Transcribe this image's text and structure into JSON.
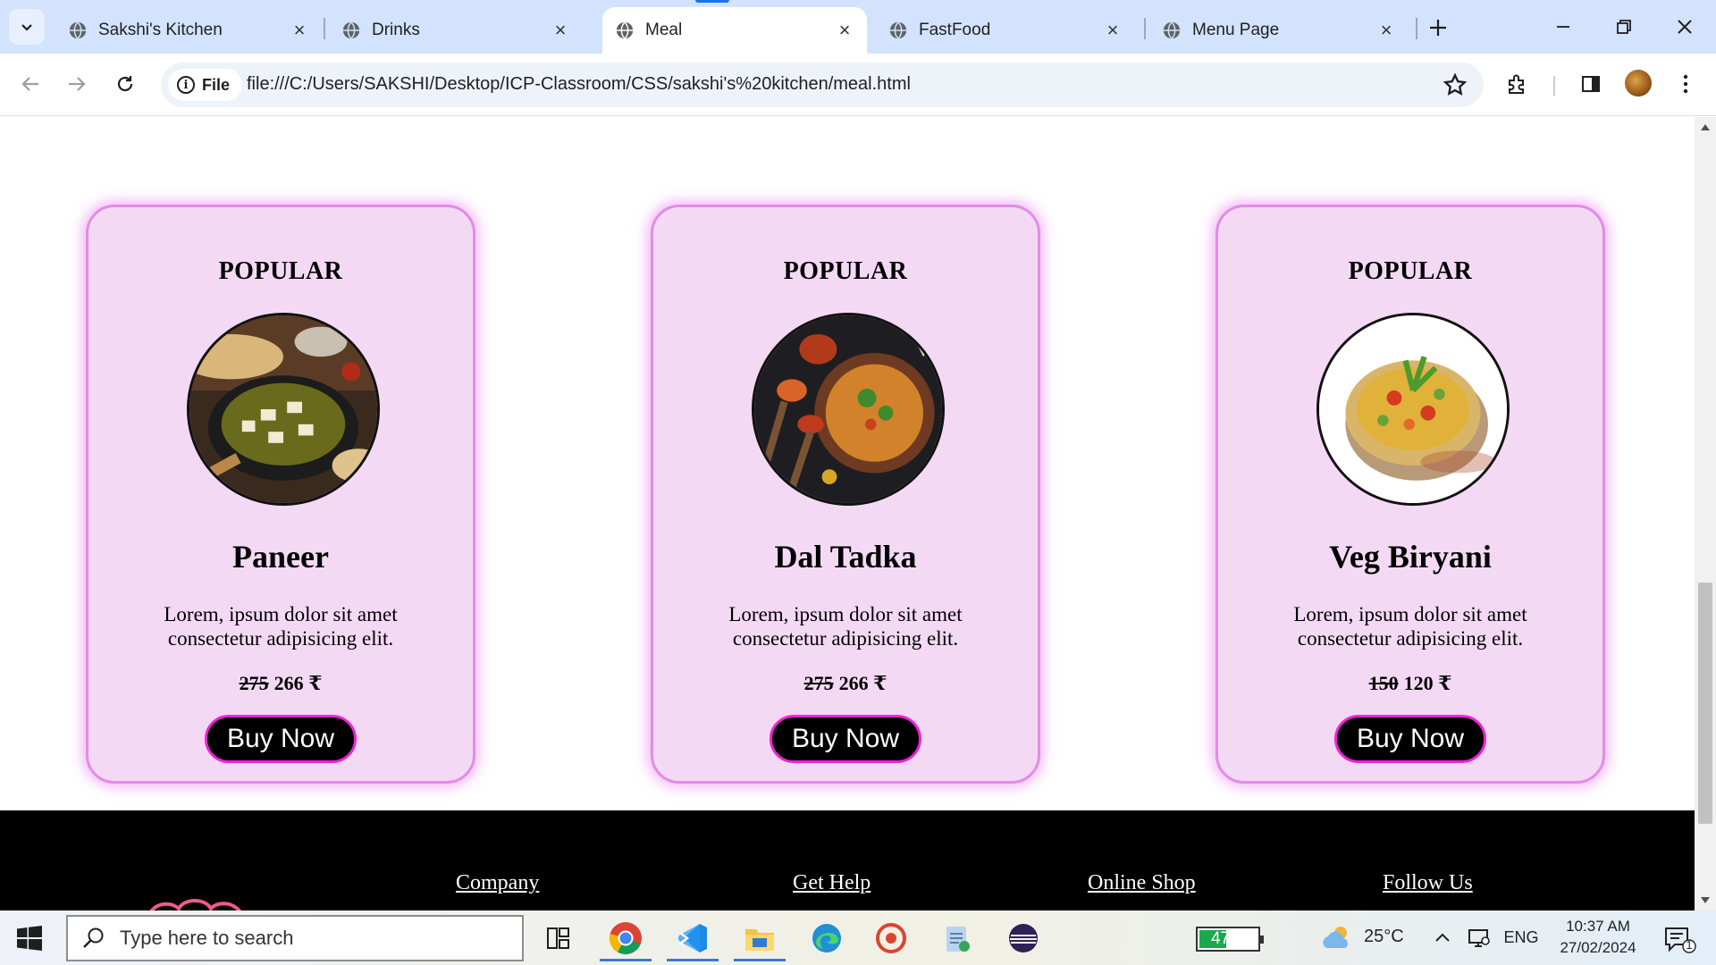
{
  "browser": {
    "tabs": [
      {
        "title": "Sakshi's Kitchen",
        "active": false
      },
      {
        "title": "Drinks",
        "active": false
      },
      {
        "title": "Meal",
        "active": true
      },
      {
        "title": "FastFood",
        "active": false
      },
      {
        "title": "Menu Page",
        "active": false
      }
    ],
    "site_chip_label": "File",
    "url": "file:///C:/Users/SAKSHI/Desktop/ICP-Classroom/CSS/sakshi's%20kitchen/meal.html",
    "accent_color": "#1a73e8"
  },
  "page": {
    "cards": [
      {
        "badge": "POPULAR",
        "name": "Paneer",
        "description": "Lorem, ipsum dolor sit amet consectetur adipisicing elit.",
        "old_price": "275",
        "price": "266 ₹",
        "button": "Buy Now",
        "image_icon": "paneer-dish-image"
      },
      {
        "badge": "POPULAR",
        "name": "Dal Tadka",
        "description": "Lorem, ipsum dolor sit amet consectetur adipisicing elit.",
        "old_price": "275",
        "price": "266 ₹",
        "button": "Buy Now",
        "image_icon": "dal-tadka-dish-image"
      },
      {
        "badge": "POPULAR",
        "name": "Veg Biryani",
        "description": "Lorem, ipsum dolor sit amet consectetur adipisicing elit.",
        "old_price": "150",
        "price": "120 ₹",
        "button": "Buy Now",
        "image_icon": "veg-biryani-dish-image"
      }
    ],
    "footer_links": [
      "Company",
      "Get Help",
      "Online Shop",
      "Follow Us"
    ],
    "colors": {
      "card_bg": "#f4d9f4",
      "card_border": "#e28ce6",
      "button_border": "#ee22d6",
      "footer_bg": "#000000"
    },
    "scroll_position_fraction": 0.59
  },
  "taskbar": {
    "search_placeholder": "Type here to search",
    "battery": "47%",
    "battery_level": 0.47,
    "temperature": "25°C",
    "language": "ENG",
    "time": "10:37 AM",
    "date": "27/02/2024",
    "notification_count": "1",
    "apps": [
      "task-view-icon",
      "chrome-icon",
      "vscode-icon",
      "file-explorer-icon",
      "edge-icon",
      "recorder-icon",
      "notepad-icon",
      "eclipse-icon"
    ]
  }
}
